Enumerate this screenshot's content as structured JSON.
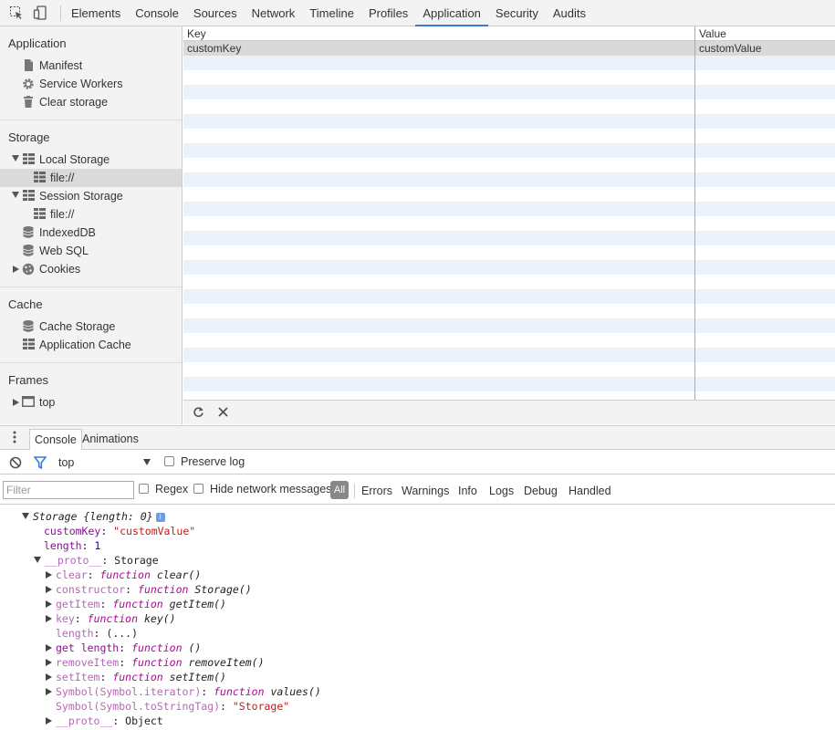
{
  "toolbar": {
    "tabs": [
      "Elements",
      "Console",
      "Sources",
      "Network",
      "Timeline",
      "Profiles",
      "Application",
      "Security",
      "Audits"
    ],
    "active_tab": "Application",
    "inspect_icon": "inspect-element-icon",
    "device_icon": "device-mode-icon"
  },
  "sidebar": {
    "application": {
      "title": "Application",
      "items": [
        {
          "label": "Manifest",
          "icon": "document-icon"
        },
        {
          "label": "Service Workers",
          "icon": "gear-icon"
        },
        {
          "label": "Clear storage",
          "icon": "trash-icon"
        }
      ]
    },
    "storage": {
      "title": "Storage",
      "local_storage": "Local Storage",
      "local_file": "file://",
      "session_storage": "Session Storage",
      "session_file": "file://",
      "indexeddb": "IndexedDB",
      "websql": "Web SQL",
      "cookies": "Cookies"
    },
    "cache": {
      "title": "Cache",
      "cache_storage": "Cache Storage",
      "app_cache": "Application Cache"
    },
    "frames": {
      "title": "Frames",
      "top": "top"
    }
  },
  "table": {
    "headers": {
      "key": "Key",
      "value": "Value"
    },
    "rows": [
      {
        "key": "customKey",
        "value": "customValue"
      }
    ]
  },
  "drawer": {
    "tabs": [
      "Console",
      "Animations"
    ],
    "active_tab": "Console",
    "context": "top",
    "preserve_log": "Preserve log",
    "filter_placeholder": "Filter",
    "regex": "Regex",
    "hide_network": "Hide network messages",
    "levels": {
      "all": "All",
      "errors": "Errors",
      "warnings": "Warnings",
      "info": "Info",
      "logs": "Logs",
      "debug": "Debug",
      "handled": "Handled"
    }
  },
  "console_lines": {
    "storage_head": "Storage",
    "storage_summary": "{length: 0}",
    "info_badge": "i",
    "custom_key": "customKey",
    "custom_val": "\"customValue\"",
    "length_key": "length",
    "length_val": "1",
    "proto_key": "__proto__",
    "proto_val": "Storage",
    "clear_key": "clear",
    "clear_val": "clear()",
    "constructor_key": "constructor",
    "constructor_val": "Storage()",
    "getitem_key": "getItem",
    "getitem_val": "getItem()",
    "key_key": "key",
    "key_val": "key()",
    "length2_key": "length",
    "length2_val": "(...)",
    "getlength_key": "get length",
    "getlength_val": "()",
    "removeitem_key": "removeItem",
    "removeitem_val": "removeItem()",
    "setitem_key": "setItem",
    "setitem_val": "setItem()",
    "symiter_key": "Symbol(Symbol.iterator)",
    "symiter_val": "values()",
    "symtag_key": "Symbol(Symbol.toStringTag)",
    "symtag_val": "\"Storage\"",
    "proto2_key": "__proto__",
    "proto2_val": "Object",
    "function_kw": "function"
  }
}
